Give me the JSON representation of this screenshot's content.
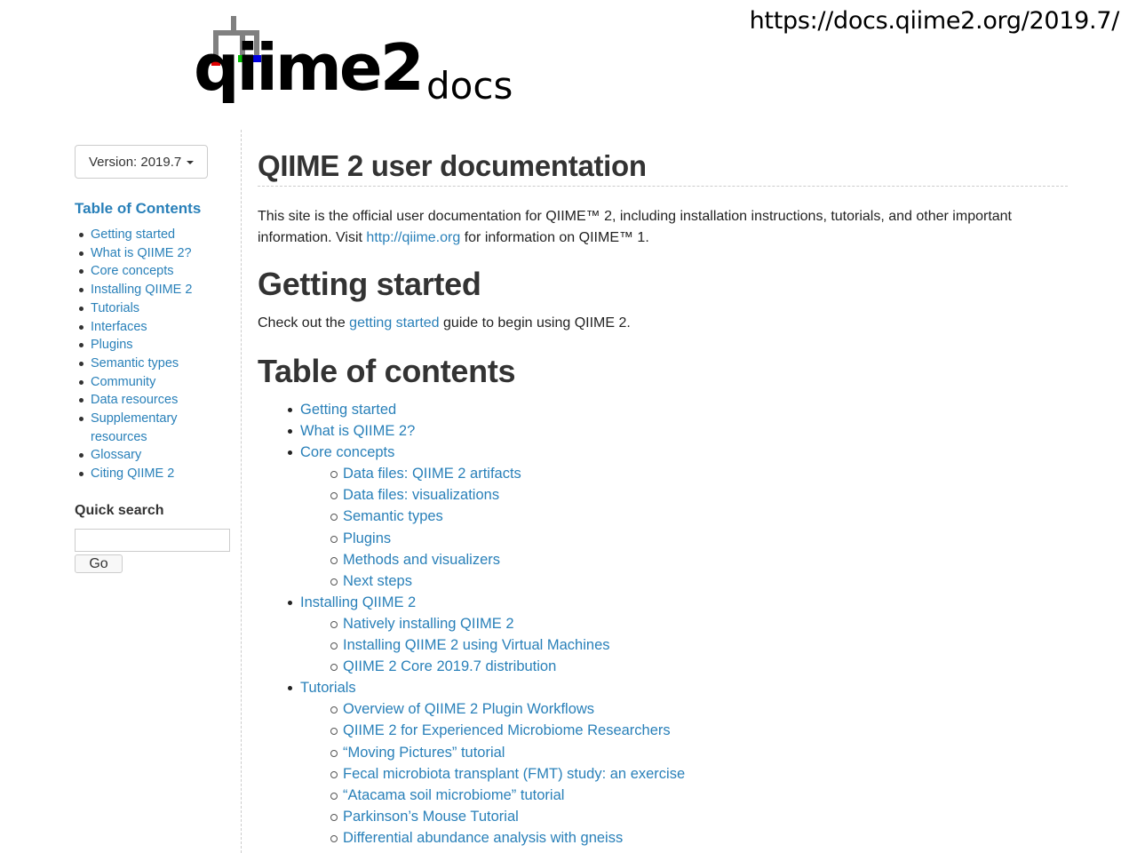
{
  "url_caption": "https://docs.qiime2.org/2019.7/",
  "logo": {
    "word": "qiime2",
    "docs": "docs",
    "colors": {
      "red": "#e00000",
      "green": "#00c000",
      "blue": "#0000e0",
      "gray": "#808080"
    }
  },
  "sidebar": {
    "version_label": "Version: 2019.7",
    "toc_title": "Table of Contents",
    "items": [
      {
        "label": "Getting started"
      },
      {
        "label": "What is QIIME 2?"
      },
      {
        "label": "Core concepts"
      },
      {
        "label": "Installing QIIME 2"
      },
      {
        "label": "Tutorials"
      },
      {
        "label": "Interfaces"
      },
      {
        "label": "Plugins"
      },
      {
        "label": "Semantic types"
      },
      {
        "label": "Community"
      },
      {
        "label": "Data resources"
      },
      {
        "label": "Supplementary resources"
      },
      {
        "label": "Glossary"
      },
      {
        "label": "Citing QIIME 2"
      }
    ],
    "quick_search_title": "Quick search",
    "search_value": "",
    "go_label": "Go"
  },
  "main": {
    "title": "QIIME 2 user documentation",
    "intro_before": "This site is the official user documentation for QIIME™ 2, including installation instructions, tutorials, and other important information. Visit ",
    "intro_link": "http://qiime.org",
    "intro_after": " for information on QIIME™ 1.",
    "getting_started_heading": "Getting started",
    "getting_started_before": "Check out the ",
    "getting_started_link": "getting started",
    "getting_started_after": " guide to begin using QIIME 2.",
    "toc_heading": "Table of contents",
    "toc": [
      {
        "label": "Getting started",
        "children": []
      },
      {
        "label": "What is QIIME 2?",
        "children": []
      },
      {
        "label": "Core concepts",
        "children": [
          "Data files: QIIME 2 artifacts",
          "Data files: visualizations",
          "Semantic types",
          "Plugins",
          "Methods and visualizers",
          "Next steps"
        ]
      },
      {
        "label": "Installing QIIME 2",
        "children": [
          "Natively installing QIIME 2",
          "Installing QIIME 2 using Virtual Machines",
          "QIIME 2 Core 2019.7 distribution"
        ]
      },
      {
        "label": "Tutorials",
        "children": [
          "Overview of QIIME 2 Plugin Workflows",
          "QIIME 2 for Experienced Microbiome Researchers",
          "“Moving Pictures” tutorial",
          "Fecal microbiota transplant (FMT) study: an exercise",
          "“Atacama soil microbiome” tutorial",
          "Parkinson’s Mouse Tutorial",
          "Differential abundance analysis with gneiss"
        ]
      }
    ]
  }
}
